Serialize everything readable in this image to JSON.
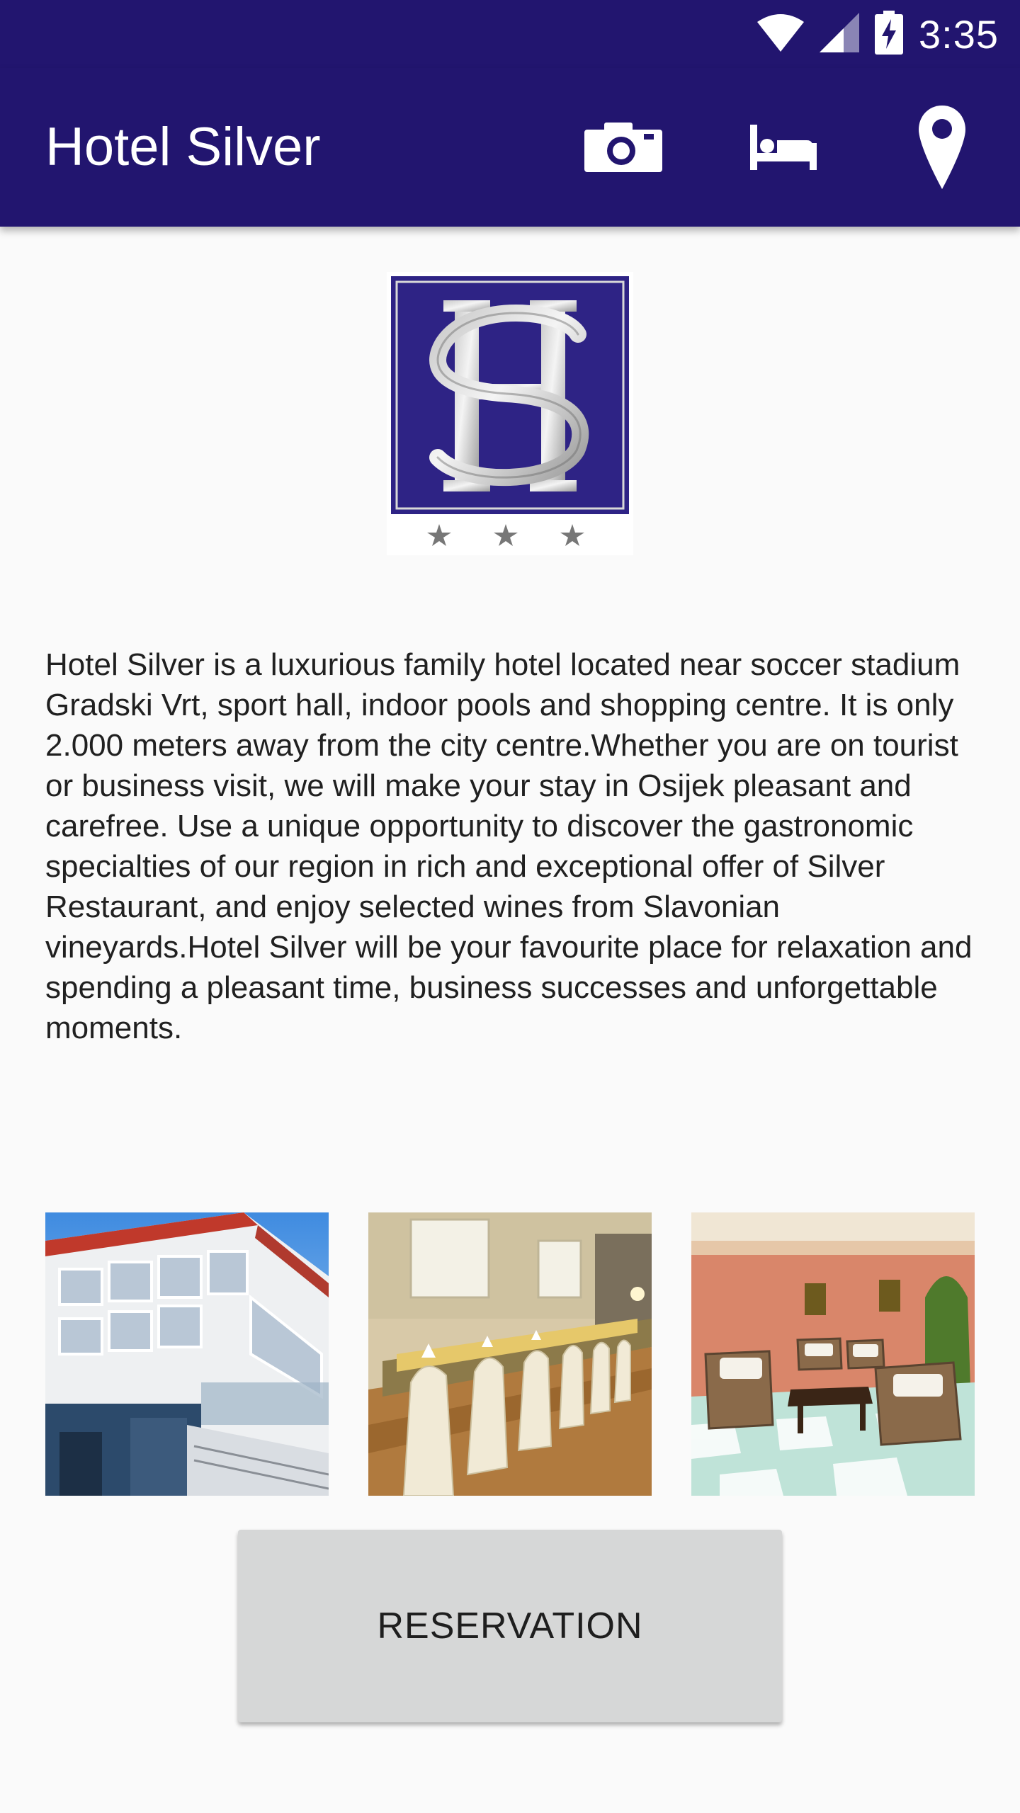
{
  "status_bar": {
    "time": "3:35",
    "icons": [
      "wifi-icon",
      "cell-signal-icon",
      "battery-charging-icon"
    ]
  },
  "app_bar": {
    "title": "Hotel Silver",
    "actions": [
      "camera-icon",
      "bed-icon",
      "location-pin-icon"
    ],
    "background_color": "#22156f"
  },
  "logo": {
    "monogram": "HS",
    "star_count": 3,
    "color": "#2e2385"
  },
  "description": "Hotel Silver is a luxurious family hotel located near soccer stadium Gradski Vrt, sport hall, indoor pools and shopping centre. It is only 2.000 meters away from the city cen­tre.Whether you are on tourist or business visit, we will make your stay in Osijek pleasant and carefree. Use a unique oppor­tunity to discover the gastronomic specialties of our region in rich and exceptional offer of Silver Restaurant, and enjoy selected wines from Slavonian vineyards.Hotel Silver will be your favourite place for relaxation and spending a pleasant time, business successes and unforgettable moments.",
  "gallery": [
    {
      "subject": "hotel-exterior-photo"
    },
    {
      "subject": "restaurant-dining-hall-photo"
    },
    {
      "subject": "lounge-lobby-photo"
    }
  ],
  "reservation_button": {
    "label": "RESERVATION"
  }
}
